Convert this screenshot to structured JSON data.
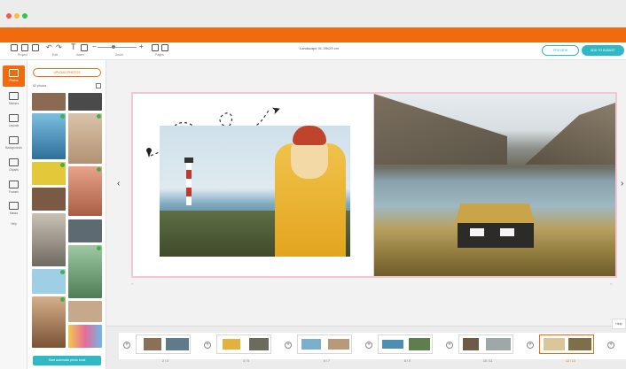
{
  "window": {
    "title": "Landscape XL 29x29 cm"
  },
  "toolbar": {
    "groups": [
      {
        "icon": "project-icon",
        "label": "Project"
      },
      {
        "icon": "edit-icon",
        "label": "Edit"
      },
      {
        "icon": "insert-icon",
        "label": "Insert"
      },
      {
        "icon": "zoom-icon",
        "label": "Zoom"
      },
      {
        "icon": "pages-icon",
        "label": "Pages"
      }
    ],
    "preview_label": "PREVIEW",
    "cart_label": "ADD TO BASKET"
  },
  "rail": {
    "items": [
      {
        "icon": "photos-icon",
        "label": "Photos",
        "active": true
      },
      {
        "icon": "stickers-icon",
        "label": "Stickers",
        "active": false
      },
      {
        "icon": "layouts-icon",
        "label": "Layouts",
        "active": false
      },
      {
        "icon": "backgrounds-icon",
        "label": "Backgrounds",
        "active": false
      },
      {
        "icon": "cliparts-icon",
        "label": "Cliparts",
        "active": false
      },
      {
        "icon": "frames-icon",
        "label": "Frames",
        "active": false
      },
      {
        "icon": "masks-icon",
        "label": "Masks",
        "active": false
      },
      {
        "icon": "help-icon",
        "label": "Help",
        "active": false
      }
    ]
  },
  "photo_panel": {
    "upload_label": "UPLOAD PHOTOS",
    "count_label": "82 photos",
    "auto_book_label": "Start automatic photo book"
  },
  "filmstrip": {
    "page_numbers": [
      "2 / 3",
      "4 / 5",
      "6 / 7",
      "8 / 9",
      "10 / 11",
      "12 / 13"
    ],
    "help_label": "Help"
  },
  "colors": {
    "brand_orange": "#f26a0e",
    "accent_teal": "#2fb9c5",
    "spread_border": "#f2c6d4",
    "selected_check": "#3cb34a"
  }
}
